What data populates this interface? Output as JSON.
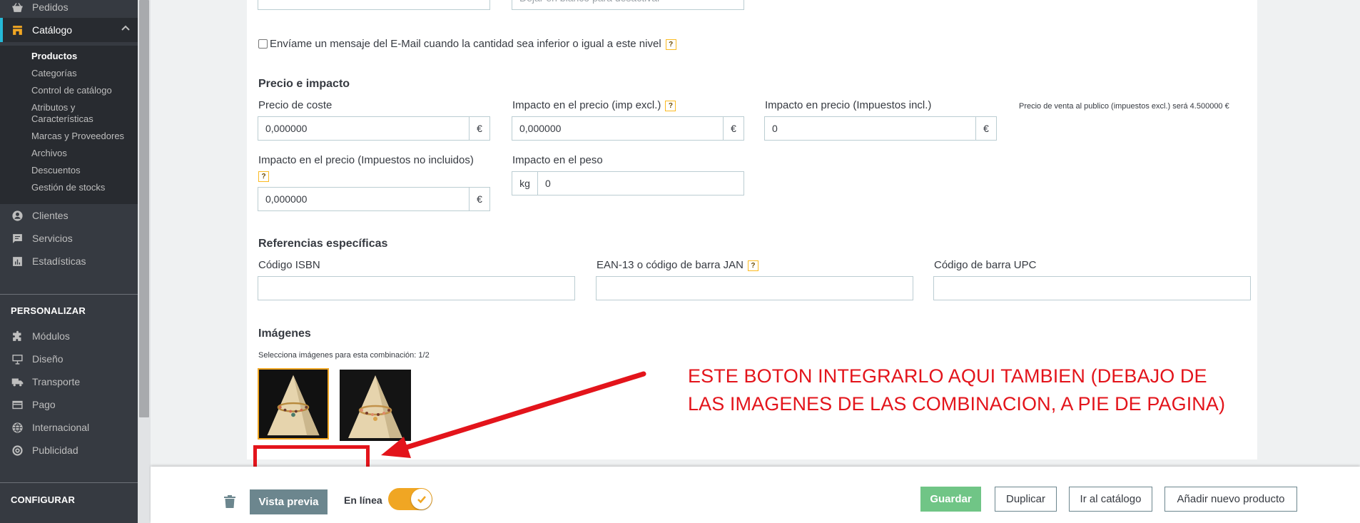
{
  "sidebar": {
    "items_top": [
      {
        "label": "Pedidos",
        "icon": "basket-icon"
      },
      {
        "label": "Catálogo",
        "icon": "store-icon"
      }
    ],
    "catalog_submenu": [
      "Productos",
      "Categorías",
      "Control de catálogo",
      "Atributos y Características",
      "Marcas y Proveedores",
      "Archivos",
      "Descuentos",
      "Gestión de stocks"
    ],
    "items_mid": [
      {
        "label": "Clientes",
        "icon": "user-icon"
      },
      {
        "label": "Servicios",
        "icon": "chat-icon"
      },
      {
        "label": "Estadísticas",
        "icon": "bar-chart-icon"
      }
    ],
    "section_personalizar": "PERSONALIZAR",
    "items_personalizar": [
      {
        "label": "Módulos",
        "icon": "puzzle-icon"
      },
      {
        "label": "Diseño",
        "icon": "monitor-icon"
      },
      {
        "label": "Transporte",
        "icon": "truck-icon"
      },
      {
        "label": "Pago",
        "icon": "credit-card-icon"
      },
      {
        "label": "Internacional",
        "icon": "globe-icon"
      },
      {
        "label": "Publicidad",
        "icon": "target-icon"
      }
    ],
    "section_configurar": "CONFIGURAR"
  },
  "form": {
    "top_input_placeholder": "Dejar en blanco para desactivar",
    "email_alert_label": "Envíame un mensaje del E-Mail cuando la cantidad sea inferior o igual a este nivel",
    "price_section_title": "Precio e impacto",
    "cost_price_label": "Precio de coste",
    "cost_price_value": "0,000000",
    "impact_excl_label": "Impacto en el precio (imp excl.)",
    "impact_excl_value": "0,000000",
    "impact_incl_label": "Impacto en precio (Impuestos incl.)",
    "impact_incl_value": "0",
    "final_price_note": "Precio de venta al publico (impuestos excl.) será 4.500000 €",
    "impact_no_tax_label": "Impacto en el precio (Impuestos no incluidos)",
    "impact_no_tax_value": "0,000000",
    "weight_label": "Impacto en el peso",
    "weight_unit": "kg",
    "weight_value": "0",
    "currency": "€",
    "help_glyph": "?",
    "refs_section_title": "Referencias específicas",
    "isbn_label": "Código ISBN",
    "ean_label": "EAN-13 o código de barra JAN",
    "upc_label": "Código de barra UPC",
    "images_section_title": "Imágenes",
    "images_hint": "Selecciona imágenes para esta combinación: 1/2"
  },
  "annotation": {
    "line1": "ESTE BOTON INTEGRARLO AQUI TAMBIEN (DEBAJO DE",
    "line2": "LAS IMAGENES DE LAS COMBINACION, A PIE DE PAGINA)",
    "color": "#e3141b"
  },
  "footer": {
    "preview_label": "Vista previa",
    "online_label": "En línea",
    "online_state": true,
    "save_label": "Guardar",
    "duplicate_label": "Duplicar",
    "go_catalog_label": "Ir al catálogo",
    "add_product_label": "Añadir nuevo producto"
  },
  "colors": {
    "sidebar_bg": "#363a41",
    "accent_orange": "#f0a623",
    "save_green": "#70c586",
    "preview_grey": "#6c868e"
  }
}
